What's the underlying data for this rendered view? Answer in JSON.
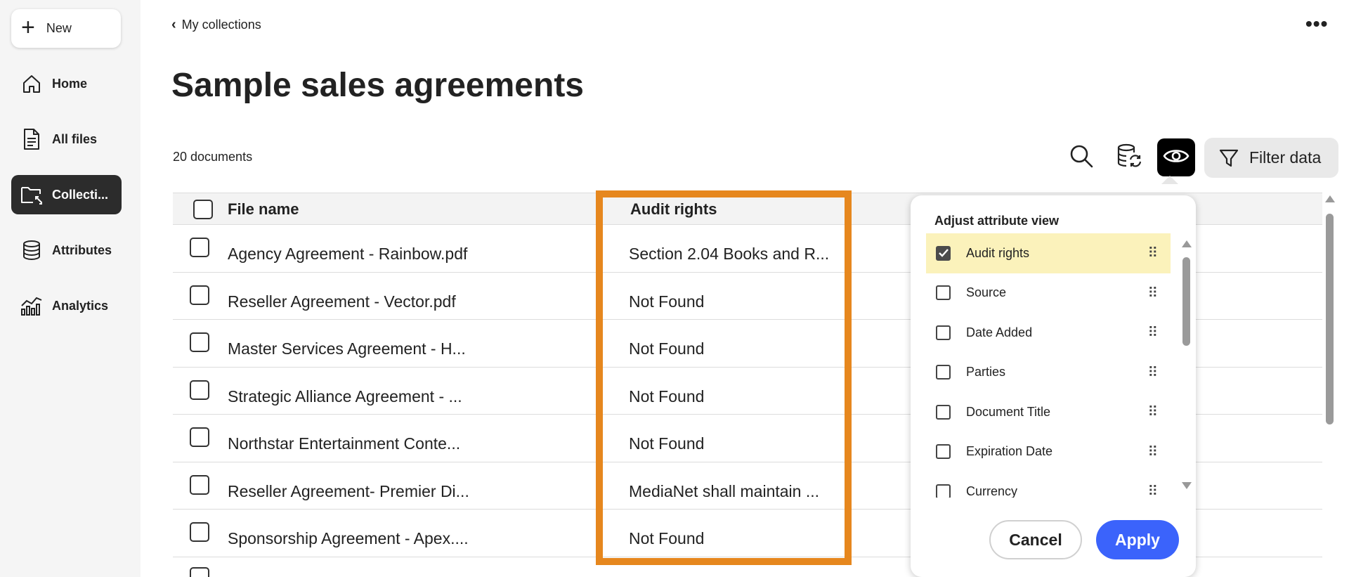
{
  "sidebar": {
    "new_label": "New",
    "items": [
      {
        "label": "Home",
        "icon": "home-icon"
      },
      {
        "label": "All files",
        "icon": "file-icon"
      },
      {
        "label": "Collecti...",
        "icon": "collection-folder-icon",
        "active": true
      },
      {
        "label": "Attributes",
        "icon": "database-icon"
      },
      {
        "label": "Analytics",
        "icon": "analytics-icon"
      }
    ]
  },
  "header": {
    "back_label": "My collections",
    "more_label": "•••",
    "title": "Sample sales agreements",
    "doc_count": "20 documents"
  },
  "toolbar": {
    "search_icon": "search-icon",
    "sync_icon": "database-sync-icon",
    "view_icon": "eye-icon",
    "filter_label": "Filter data",
    "accent_active": "#000000"
  },
  "table": {
    "columns": [
      "File name",
      "Audit rights"
    ],
    "rows": [
      {
        "name": "Agency Agreement - Rainbow.pdf",
        "audit": "Section 2.04 Books and R..."
      },
      {
        "name": "Reseller Agreement - Vector.pdf",
        "audit": "Not Found"
      },
      {
        "name": "Master Services Agreement - H...",
        "audit": "Not Found"
      },
      {
        "name": "Strategic Alliance Agreement - ...",
        "audit": "Not Found"
      },
      {
        "name": "Northstar Entertainment Conte...",
        "audit": "Not Found"
      },
      {
        "name": "Reseller Agreement- Premier Di...",
        "audit": "MediaNet shall maintain ..."
      },
      {
        "name": "Sponsorship Agreement - Apex....",
        "audit": "Not Found"
      }
    ]
  },
  "popover": {
    "title": "Adjust attribute view",
    "items": [
      {
        "label": "Audit rights",
        "checked": true
      },
      {
        "label": "Source",
        "checked": false
      },
      {
        "label": "Date Added",
        "checked": false
      },
      {
        "label": "Parties",
        "checked": false
      },
      {
        "label": "Document Title",
        "checked": false
      },
      {
        "label": "Expiration Date",
        "checked": false
      },
      {
        "label": "Currency",
        "checked": false
      }
    ],
    "cancel_label": "Cancel",
    "apply_label": "Apply"
  },
  "colors": {
    "highlight": "#e6871e",
    "apply": "#3b63fb",
    "selected_row": "#fbf2bb",
    "sidebar_active": "#2c2c2c"
  }
}
